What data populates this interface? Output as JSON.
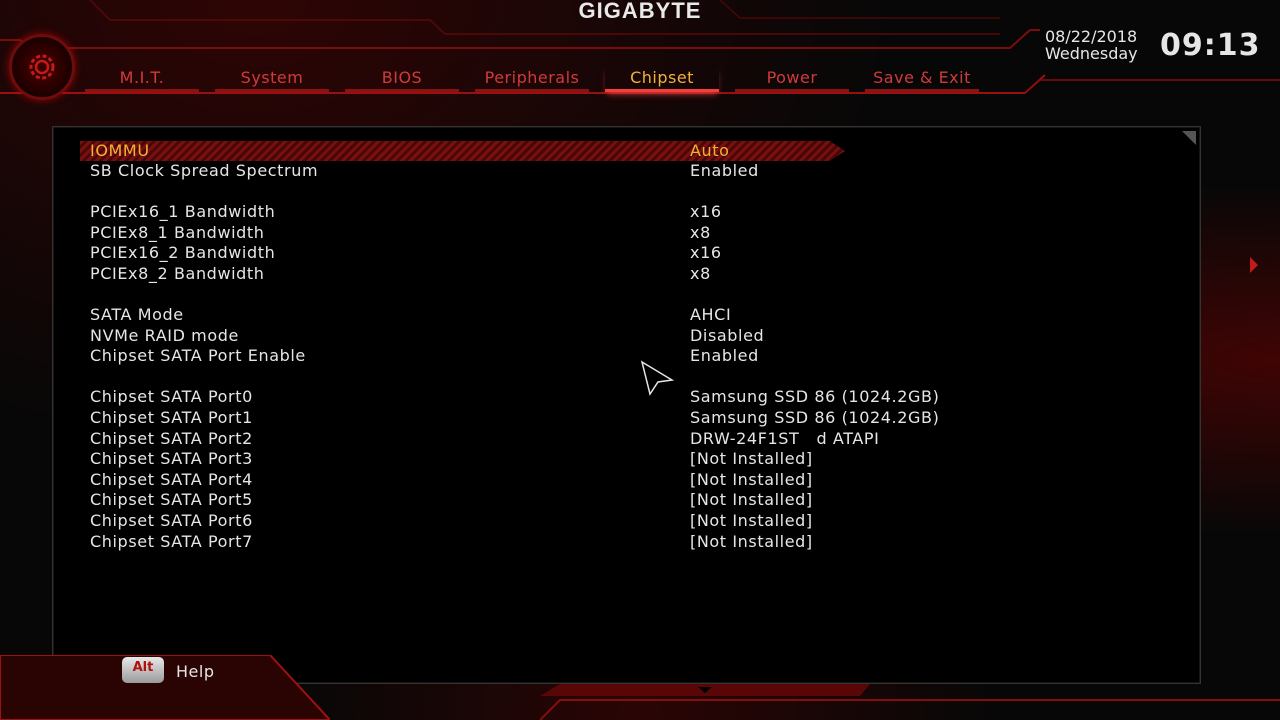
{
  "header": {
    "brand": "GIGABYTE",
    "date": "08/22/2018",
    "weekday": "Wednesday",
    "time": "09:13",
    "tabs": [
      {
        "label": "M.I.T.",
        "active": false
      },
      {
        "label": "System",
        "active": false
      },
      {
        "label": "BIOS",
        "active": false
      },
      {
        "label": "Peripherals",
        "active": false
      },
      {
        "label": "Chipset",
        "active": true
      },
      {
        "label": "Power",
        "active": false
      },
      {
        "label": "Save & Exit",
        "active": false
      }
    ]
  },
  "settings": [
    {
      "label": "IOMMU",
      "value": "Auto",
      "selected": true
    },
    {
      "label": "SB Clock Spread Spectrum",
      "value": "Enabled"
    },
    {
      "label": "PCIEx16_1 Bandwidth",
      "value": "x16"
    },
    {
      "label": "PCIEx8_1 Bandwidth",
      "value": "x8"
    },
    {
      "label": "PCIEx16_2 Bandwidth",
      "value": "x16"
    },
    {
      "label": "PCIEx8_2 Bandwidth",
      "value": "x8"
    },
    {
      "label": "SATA Mode",
      "value": "AHCI"
    },
    {
      "label": "NVMe RAID mode",
      "value": "Disabled"
    },
    {
      "label": "Chipset SATA Port Enable",
      "value": "Enabled"
    },
    {
      "label": "Chipset SATA Port0",
      "value": "Samsung SSD 86 (1024.2GB)"
    },
    {
      "label": "Chipset SATA Port1",
      "value": "Samsung SSD 86 (1024.2GB)"
    },
    {
      "label": "Chipset SATA Port2",
      "value": "DRW-24F1ST   d ATAPI"
    },
    {
      "label": "Chipset SATA Port3",
      "value": "[Not Installed]"
    },
    {
      "label": "Chipset SATA Port4",
      "value": "[Not Installed]"
    },
    {
      "label": "Chipset SATA Port5",
      "value": "[Not Installed]"
    },
    {
      "label": "Chipset SATA Port6",
      "value": "[Not Installed]"
    },
    {
      "label": "Chipset SATA Port7",
      "value": "[Not Installed]"
    }
  ],
  "footer": {
    "alt_key": "Alt",
    "help_label": "Help"
  },
  "colors": {
    "accent_red": "#d23a3a",
    "selected_gold": "#f2b23a",
    "frame_red": "#8a1212"
  }
}
